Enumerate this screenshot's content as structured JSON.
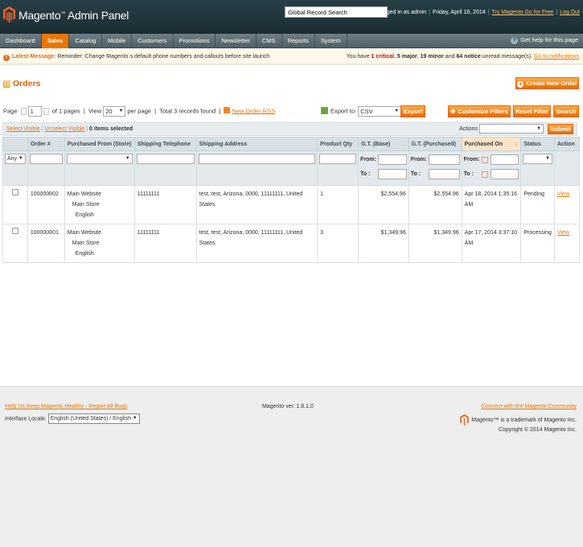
{
  "header": {
    "title": "Magento",
    "subtitle": "Admin Panel",
    "search_value": "Global Record Search",
    "logged_in": "Logged in as admin",
    "date": "Friday, April 18, 2014",
    "try_link": "Try Magento Go for Free",
    "logout": "Log Out"
  },
  "nav": {
    "items": [
      "Dashboard",
      "Sales",
      "Catalog",
      "Mobile",
      "Customers",
      "Promotions",
      "Newsletter",
      "CMS",
      "Reports",
      "System"
    ],
    "active": "Sales",
    "help": "Get help for this page"
  },
  "message": {
    "label": "Latest Message:",
    "text": "Reminder: Change Magento`s default phone numbers and callouts before site launch",
    "counts_prefix": "You have",
    "critical": "1 critical",
    "major": "5 major",
    "minor": "19 minor",
    "notice_pre": "and",
    "notice": "64 notice",
    "suffix": "unread message(s).",
    "link": "Go to notifications"
  },
  "page": {
    "title": "Orders",
    "create_button": "Create New Order"
  },
  "pager": {
    "page_label": "Page",
    "page_value": "1",
    "of_pages": "of 1 pages",
    "view_label": "View",
    "per_page_value": "20",
    "per_page_label": "per page",
    "total": "Total 3 records found",
    "rss": "New Order RSS"
  },
  "export": {
    "label": "Export to:",
    "format": "CSV",
    "button": "Export",
    "customize": "Customize Filters",
    "reset": "Reset Filter",
    "search": "Search"
  },
  "mass": {
    "select_visible": "Select Visible",
    "unselect_visible": "Unselect Visible",
    "selected": "0 items selected",
    "actions_label": "Actions",
    "submit": "Submit"
  },
  "columns": [
    "",
    "Order #",
    "Purchased From (Store)",
    "Shipping Telephone",
    "Shipping Address",
    "Product Qty",
    "G.T. (Base)",
    "G.T. (Purchased)",
    "Purchased On",
    "Status",
    "Action"
  ],
  "filter": {
    "any": "Any",
    "from": "From:",
    "to": "To :"
  },
  "rows": [
    {
      "order": "100000002",
      "store1": "Main Website",
      "store2": "Main Store",
      "store3": "English",
      "phone": "11111111",
      "address": "test, test, Arizona, 0000, 11111111, United States",
      "qty": "1",
      "gt_base": "$2,554.96",
      "gt_purchased": "$2,554.96",
      "purchased_on": "Apr 18, 2014 1:35:16 AM",
      "status": "Pending",
      "action": "View"
    },
    {
      "order": "100000001",
      "store1": "Main Website",
      "store2": "Main Store",
      "store3": "English",
      "phone": "11111111",
      "address": "test, test, Arizona, 0000, 11111111, United States",
      "qty": "3",
      "gt_base": "$1,349.96",
      "gt_purchased": "$1,349.96",
      "purchased_on": "Apr 17, 2014 3:37:10 AM",
      "status": "Processing",
      "action": "View"
    }
  ],
  "footer": {
    "help_link": "Help Us Keep Magento Healthy - Report All Bugs",
    "locale_label": "Interface Locale:",
    "locale_value": "English (United States) / English",
    "version": "Magento ver. 1.8.1.0",
    "community": "Connect with the Magento Community",
    "trademark": "Magento™ is a trademark of Magento Inc.",
    "copyright": "Copyright © 2014 Magento Inc."
  },
  "colors": {
    "accent": "#ea7601",
    "header_bg": "#1b2c33",
    "title": "#eb5e00"
  }
}
